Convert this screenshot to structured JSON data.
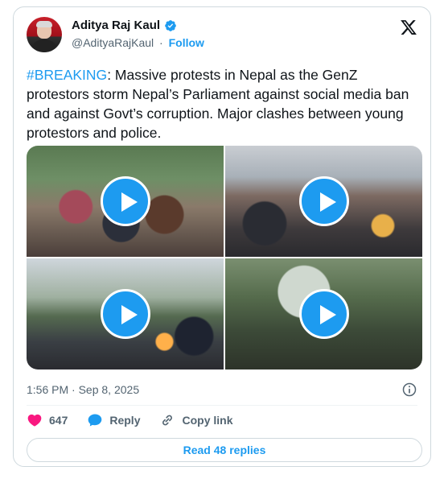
{
  "author": {
    "name": "Aditya Raj Kaul",
    "handle": "@AdityaRajKaul",
    "separator": "·",
    "follow_label": "Follow",
    "verified": true
  },
  "icons": {
    "verified": "verified-badge-icon",
    "platform": "x-logo-icon",
    "info": "info-icon",
    "like": "heart-icon",
    "reply": "reply-bubble-icon",
    "copy_link": "link-icon",
    "play": "play-icon"
  },
  "tweet": {
    "hashtag": "#BREAKING",
    "body": ": Massive protests in Nepal as the GenZ protestors storm Nepal’s Parliament against social media ban and against Govt’s corruption. Major clashes between young protestors and police."
  },
  "media": {
    "videos": [
      {
        "type": "video"
      },
      {
        "type": "video"
      },
      {
        "type": "video"
      },
      {
        "type": "video"
      }
    ]
  },
  "meta": {
    "time": "1:56 PM",
    "separator": "·",
    "date": "Sep 8, 2025"
  },
  "actions": {
    "likes": "647",
    "reply_label": "Reply",
    "copy_link_label": "Copy link"
  },
  "footer": {
    "read_replies_label": "Read 48 replies"
  },
  "colors": {
    "accent": "#1d9bf0",
    "like": "#f91880",
    "text": "#0f1419",
    "secondary": "#536471",
    "border": "#cfd9de"
  }
}
